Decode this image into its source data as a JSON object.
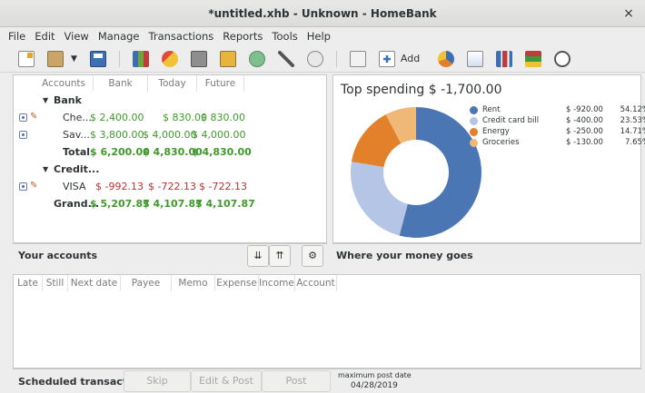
{
  "window": {
    "title": "*untitled.xhb - Unknown - HomeBank",
    "close_glyph": "×"
  },
  "menu": [
    "File",
    "Edit",
    "View",
    "Manage",
    "Transactions",
    "Reports",
    "Tools",
    "Help"
  ],
  "toolbar": {
    "add_label": "Add"
  },
  "accounts": {
    "columns": [
      "Accounts",
      "Bank",
      "Today",
      "Future"
    ],
    "rows": [
      {
        "kind": "group",
        "name": "Bank"
      },
      {
        "kind": "account",
        "name": "Che...",
        "bank": "$ 2,400.00",
        "today": "$ 830.00",
        "future": "$ 830.00",
        "tone": "green",
        "edit": true
      },
      {
        "kind": "account",
        "name": "Sav...",
        "bank": "$ 3,800.00",
        "today": "$ 4,000.00",
        "future": "$ 4,000.00",
        "tone": "green",
        "edit": false
      },
      {
        "kind": "total",
        "name": "Total",
        "bank": "$ 6,200.00",
        "today": "$ 4,830.00",
        "future": "$ 4,830.00",
        "tone": "green"
      },
      {
        "kind": "group",
        "name": "Credit..."
      },
      {
        "kind": "account",
        "name": "VISA",
        "bank": "$ -992.13",
        "today": "$ -722.13",
        "future": "$ -722.13",
        "tone": "red",
        "edit": true
      },
      {
        "kind": "grand",
        "name": "Grand...",
        "bank": "$ 5,207.87",
        "today": "$ 4,107.87",
        "future": "$ 4,107.87",
        "tone": "green"
      }
    ],
    "footer_label": "Your accounts"
  },
  "spending": {
    "title": "Top spending $ -1,700.00",
    "footer_label": "Where your money goes"
  },
  "chart_data": {
    "type": "pie",
    "title": "Top spending $ -1,700.00",
    "legend_position": "right",
    "slices": [
      {
        "label": "Rent",
        "amount": "$ -920.00",
        "percent_label": "54.12%",
        "value": 920,
        "color": "#4a76b3"
      },
      {
        "label": "Credit card bill",
        "amount": "$ -400.00",
        "percent_label": "23.53%",
        "value": 400,
        "color": "#b5c5e5"
      },
      {
        "label": "Energy",
        "amount": "$ -250.00",
        "percent_label": "14.71%",
        "value": 250,
        "color": "#e3812a"
      },
      {
        "label": "Groceries",
        "amount": "$ -130.00",
        "percent_label": "7.65%",
        "value": 130,
        "color": "#f0b877"
      }
    ]
  },
  "scheduled": {
    "columns": [
      "Late",
      "Still",
      "Next date",
      "Payee",
      "Memo",
      "Expense",
      "Income",
      "Account"
    ],
    "footer_label": "Scheduled transactions",
    "skip_label": "Skip",
    "edit_post_label": "Edit & Post",
    "post_label": "Post",
    "max_post_label": "maximum post date",
    "max_post_date": "04/28/2019"
  }
}
